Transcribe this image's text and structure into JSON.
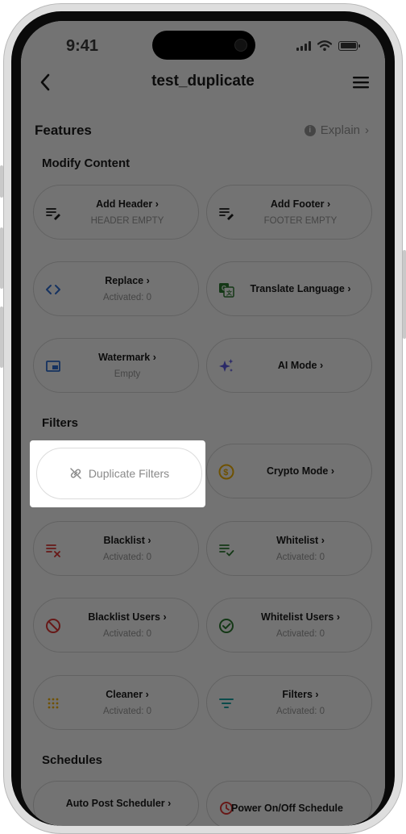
{
  "status_bar": {
    "time": "9:41"
  },
  "header": {
    "title": "test_duplicate"
  },
  "features": {
    "title": "Features",
    "explain_label": "Explain"
  },
  "sections": {
    "modify_content": "Modify Content",
    "filters": "Filters",
    "schedules": "Schedules"
  },
  "cards": {
    "add_header": {
      "title": "Add Header",
      "subtitle": "HEADER EMPTY",
      "icon": "edit-lines-icon"
    },
    "add_footer": {
      "title": "Add Footer",
      "subtitle": "FOOTER EMPTY",
      "icon": "edit-lines-icon"
    },
    "replace": {
      "title": "Replace",
      "subtitle": "Activated: 0",
      "icon": "code-icon"
    },
    "translate": {
      "title": "Translate Language",
      "icon": "translate-icon"
    },
    "watermark": {
      "title": "Watermark",
      "subtitle": "Empty",
      "icon": "image-icon"
    },
    "ai_mode": {
      "title": "AI Mode",
      "icon": "sparkle-icon"
    },
    "duplicate_filters": {
      "title": "Duplicate Filters",
      "icon": "link-off-icon"
    },
    "crypto_mode": {
      "title": "Crypto Mode",
      "icon": "coin-icon"
    },
    "blacklist": {
      "title": "Blacklist",
      "subtitle": "Activated: 0",
      "icon": "list-remove-icon"
    },
    "whitelist": {
      "title": "Whitelist",
      "subtitle": "Activated: 0",
      "icon": "list-check-icon"
    },
    "blacklist_users": {
      "title": "Blacklist Users",
      "subtitle": "Activated: 0",
      "icon": "block-icon"
    },
    "whitelist_users": {
      "title": "Whitelist Users",
      "subtitle": "Activated: 0",
      "icon": "check-circle-icon"
    },
    "cleaner": {
      "title": "Cleaner",
      "subtitle": "Activated: 0",
      "icon": "dots-grid-icon"
    },
    "filters_card": {
      "title": "Filters",
      "subtitle": "Activated: 0",
      "icon": "filter-icon"
    },
    "auto_post": {
      "title": "Auto Post Scheduler"
    },
    "power_onoff": {
      "title": "Power On/Off Schedule"
    }
  },
  "colors": {
    "accent_blue": "#2f6fd6",
    "red": "#e53935",
    "green": "#2e7d32",
    "purple": "#5e5ce6",
    "yellow": "#f5b400",
    "teal": "#1aa6a6"
  }
}
